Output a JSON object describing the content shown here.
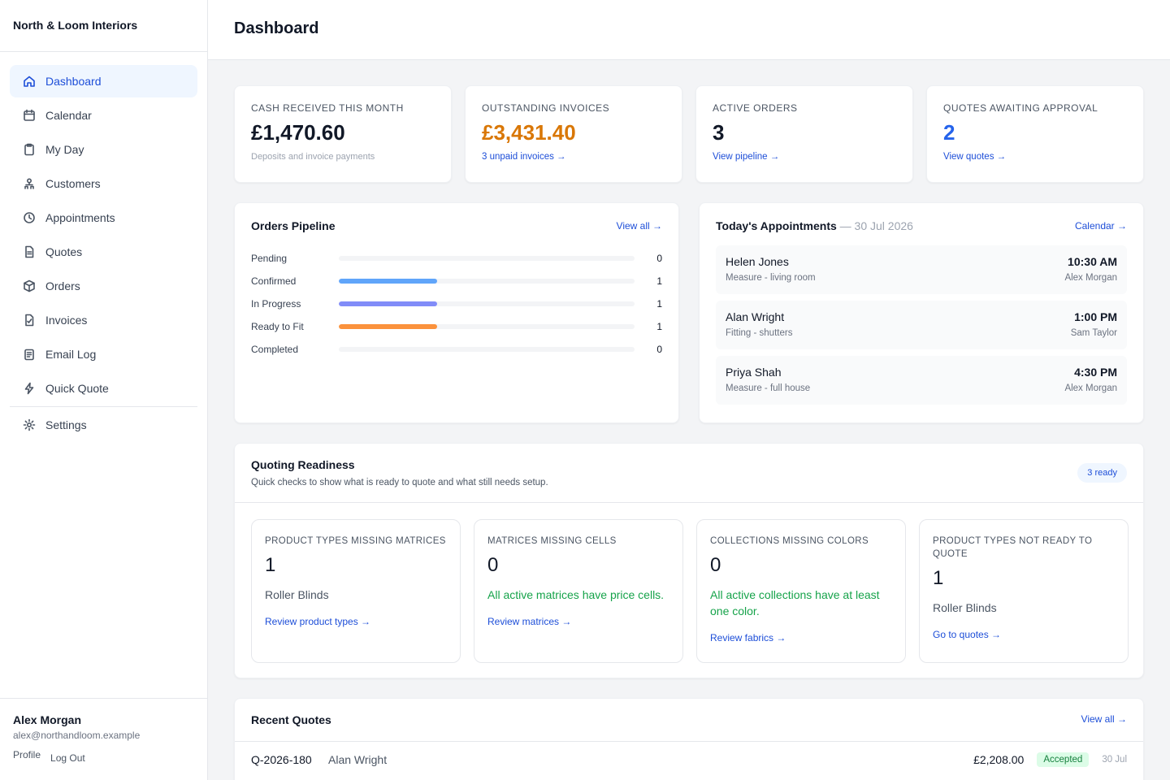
{
  "brand": "North & Loom Interiors",
  "nav": [
    {
      "label": "Dashboard",
      "icon": "home-icon",
      "active": true
    },
    {
      "label": "Calendar",
      "icon": "calendar-icon"
    },
    {
      "label": "My Day",
      "icon": "clipboard-icon"
    },
    {
      "label": "Customers",
      "icon": "users-icon"
    },
    {
      "label": "Appointments",
      "icon": "clock-icon"
    },
    {
      "label": "Quotes",
      "icon": "document-icon"
    },
    {
      "label": "Orders",
      "icon": "box-icon"
    },
    {
      "label": "Invoices",
      "icon": "receipt-icon"
    },
    {
      "label": "Email Log",
      "icon": "mail-log-icon"
    },
    {
      "label": "Quick Quote",
      "icon": "lightning-icon"
    }
  ],
  "settings": {
    "label": "Settings",
    "icon": "gear-icon"
  },
  "user": {
    "name": "Alex Morgan",
    "email": "alex@northandloom.example",
    "profile": "Profile",
    "logout": "Log Out"
  },
  "page_title": "Dashboard",
  "stats": [
    {
      "label": "Cash received this month",
      "value": "£1,470.60",
      "sub": "Deposits and invoice payments"
    },
    {
      "label": "Outstanding invoices",
      "value": "£3,431.40",
      "link": "3 unpaid invoices →"
    },
    {
      "label": "Active orders",
      "value": "3",
      "link": "View pipeline →"
    },
    {
      "label": "Quotes awaiting approval",
      "value": "2",
      "link": "View quotes →"
    }
  ],
  "pipeline": {
    "title": "Orders Pipeline",
    "link": "View all →",
    "max": 3,
    "rows": [
      {
        "label": "Pending",
        "count": "0",
        "value": 0,
        "color": "#d1d5db"
      },
      {
        "label": "Confirmed",
        "count": "1",
        "value": 1,
        "color": "#60a5fa"
      },
      {
        "label": "In Progress",
        "count": "1",
        "value": 1,
        "color": "#818cf8"
      },
      {
        "label": "Ready to Fit",
        "count": "1",
        "value": 1,
        "color": "#fb923c"
      },
      {
        "label": "Completed",
        "count": "0",
        "value": 0,
        "color": "#34d399"
      }
    ]
  },
  "appointments": {
    "title": "Today's Appointments",
    "date": " — 30 Jul 2026",
    "link": "Calendar →",
    "items": [
      {
        "name": "Helen Jones",
        "desc": "Measure - living room",
        "time": "10:30 AM",
        "staff": "Alex Morgan"
      },
      {
        "name": "Alan Wright",
        "desc": "Fitting - shutters",
        "time": "1:00 PM",
        "staff": "Sam Taylor"
      },
      {
        "name": "Priya Shah",
        "desc": "Measure - full house",
        "time": "4:30 PM",
        "staff": "Alex Morgan"
      }
    ]
  },
  "readiness": {
    "title": "Quoting Readiness",
    "subtitle": "Quick checks to show what is ready to quote and what still needs setup.",
    "badge": "3 ready",
    "cards": [
      {
        "label": "Product types missing matrices",
        "value": "1",
        "note": "Roller Blinds",
        "ok": false,
        "link": "Review product types →"
      },
      {
        "label": "Matrices missing cells",
        "value": "0",
        "note": "All active matrices have price cells.",
        "ok": true,
        "link": "Review matrices →"
      },
      {
        "label": "Collections missing colors",
        "value": "0",
        "note": "All active collections have at least one color.",
        "ok": true,
        "link": "Review fabrics →"
      },
      {
        "label": "Product types not ready to quote",
        "value": "1",
        "note": "Roller Blinds",
        "ok": false,
        "link": "Go to quotes →"
      }
    ]
  },
  "recent_quotes": {
    "title": "Recent Quotes",
    "link": "View all →",
    "rows": [
      {
        "id": "Q-2026-180",
        "customer": "Alan Wright",
        "amount": "£2,208.00",
        "status": "Accepted",
        "date": "30 Jul"
      }
    ]
  },
  "colors": {
    "accent": "#1d4ed8",
    "orange": "#d97706",
    "blue": "#2563eb",
    "green": "#16a34a"
  }
}
